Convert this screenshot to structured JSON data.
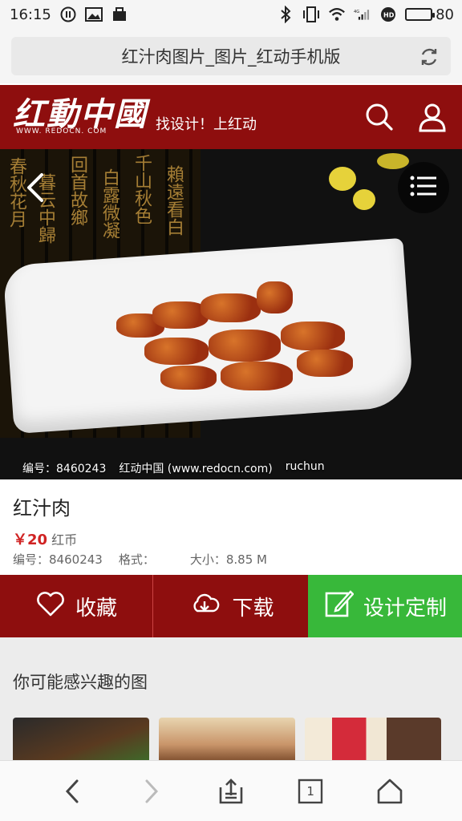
{
  "status_bar": {
    "time": "16:15",
    "battery": "80",
    "battery_level": 0.8,
    "network": "4G"
  },
  "address_bar": {
    "title": "红汁肉图片_图片_红动手机版"
  },
  "header": {
    "logo_text": "红動中國",
    "logo_sub": "WWW. REDOCN. COM",
    "slogan": "找设计！上红动"
  },
  "hero": {
    "caption_id": "编号：8460243",
    "caption_site": "红动中国 (www.redocn.com)",
    "caption_author": "ruchun",
    "calligraphy": [
      "春秋花月",
      "暮云中歸",
      "回首故鄉",
      "白露微凝",
      "千山秋色",
      "賴遠看白"
    ]
  },
  "product": {
    "title": "红汁肉",
    "price_symbol": "￥",
    "price_value": "20",
    "price_unit": "红币",
    "id_label": "编号：",
    "id_value": "8460243",
    "format_label": "格式：",
    "format_value": "",
    "size_label": "大小：",
    "size_value": "8.85 M"
  },
  "actions": {
    "favorite": "收藏",
    "download": "下载",
    "design": "设计定制"
  },
  "related": {
    "title": "你可能感兴趣的图"
  },
  "bottom_nav": {
    "tab_count": "1"
  },
  "colors": {
    "brand_red": "#8e0e0e",
    "green": "#38b83a",
    "price_red": "#d02323"
  }
}
